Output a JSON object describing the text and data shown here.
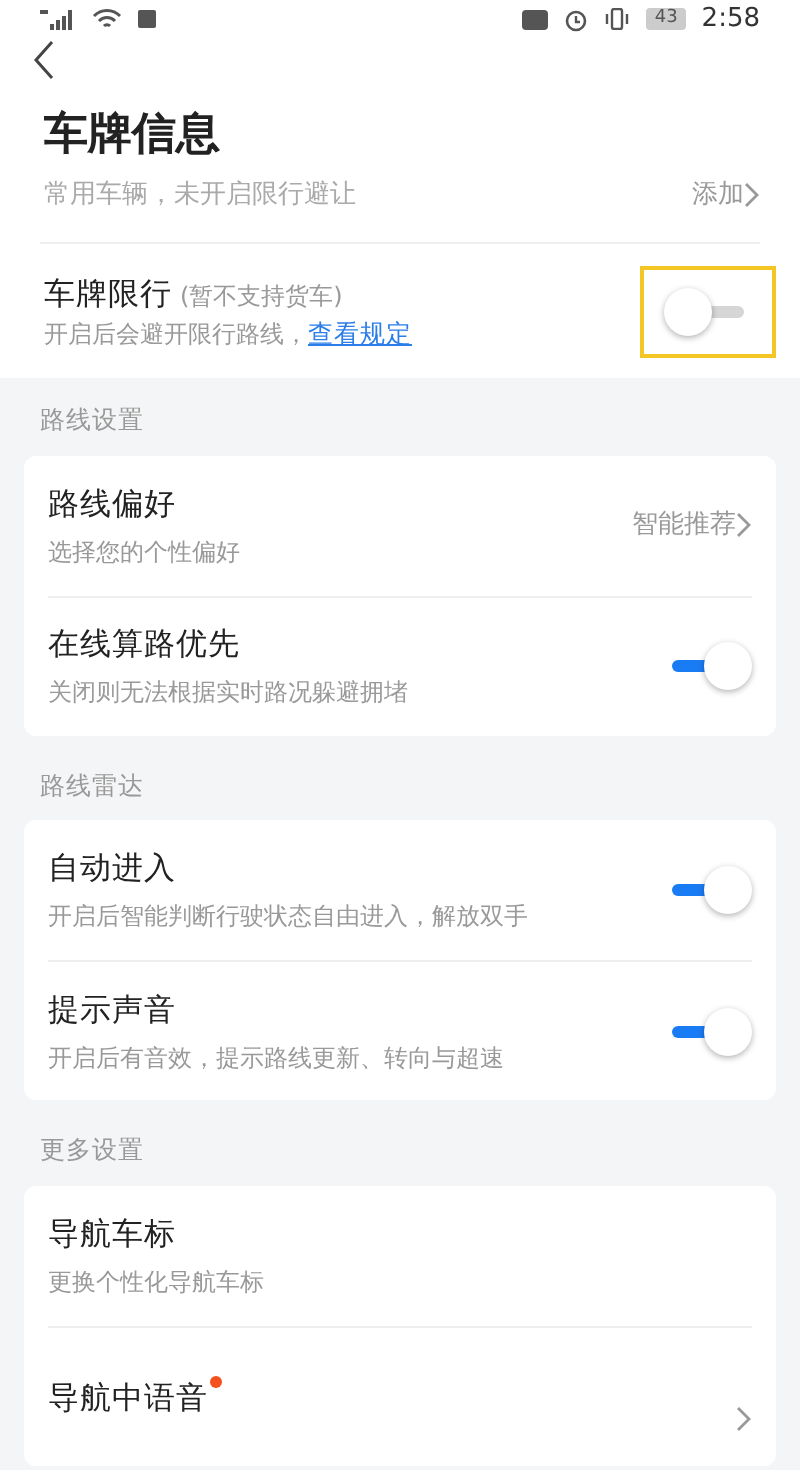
{
  "status_bar": {
    "time": "2:58",
    "battery": "43"
  },
  "header": {
    "title": "车牌信息",
    "subtitle": "常用车辆，未开启限行避让",
    "action": "添加"
  },
  "plate_restriction": {
    "title": "车牌限行",
    "note": "(暂不支持货车)",
    "description": "开启后会避开限行路线，",
    "link": "查看规定",
    "on": false,
    "highlighted": true
  },
  "sections": [
    {
      "title": "路线设置",
      "items": [
        {
          "kind": "link",
          "title": "路线偏好",
          "description": "选择您的个性偏好",
          "value": "智能推荐",
          "new_dot": false
        },
        {
          "kind": "toggle",
          "title": "在线算路优先",
          "description": "关闭则无法根据实时路况躲避拥堵",
          "on": true,
          "new_dot": false
        }
      ]
    },
    {
      "title": "路线雷达",
      "items": [
        {
          "kind": "toggle",
          "title": "自动进入",
          "description": "开启后智能判断行驶状态自由进入，解放双手",
          "on": true,
          "new_dot": false
        },
        {
          "kind": "toggle",
          "title": "提示声音",
          "description": "开启后有音效，提示路线更新、转向与超速",
          "on": true,
          "new_dot": false
        }
      ]
    },
    {
      "title": "更多设置",
      "items": [
        {
          "kind": "plain",
          "title": "导航车标",
          "description": "更换个性化导航车标",
          "new_dot": false
        },
        {
          "kind": "link",
          "title": "导航中语音",
          "new_dot": true
        }
      ]
    }
  ]
}
